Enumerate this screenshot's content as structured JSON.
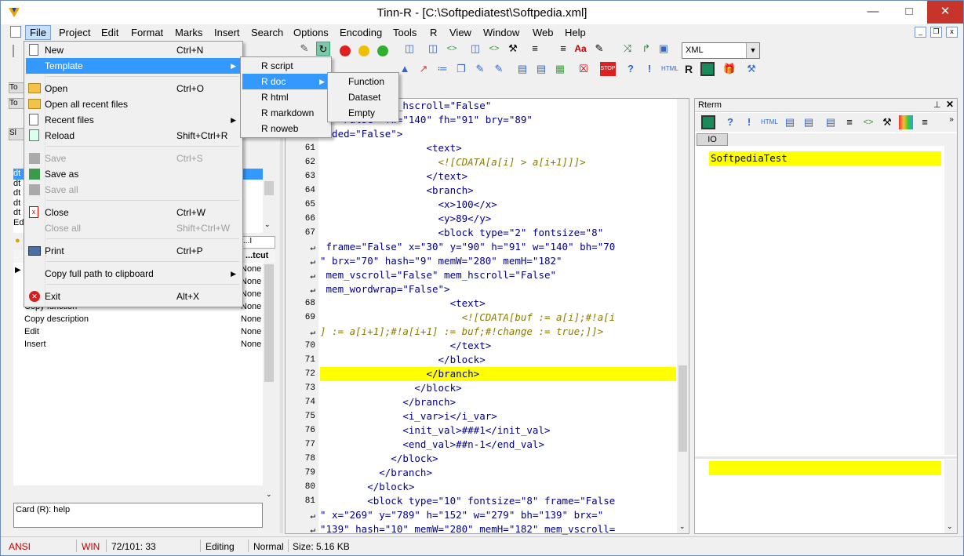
{
  "window": {
    "title": "Tinn-R - [C:\\Softpediatest\\Softpedia.xml]"
  },
  "menubar": [
    "File",
    "Project",
    "Edit",
    "Format",
    "Marks",
    "Insert",
    "Search",
    "Options",
    "Encoding",
    "Tools",
    "R",
    "View",
    "Window",
    "Web",
    "Help"
  ],
  "file_menu": [
    {
      "label": "New",
      "shortcut": "Ctrl+N",
      "disabled": false
    },
    {
      "label": "Template",
      "shortcut": "",
      "disabled": false,
      "submenu": true
    },
    {
      "label": "Open",
      "shortcut": "Ctrl+O",
      "disabled": false
    },
    {
      "label": "Open all recent files",
      "shortcut": "",
      "disabled": false
    },
    {
      "label": "Recent files",
      "shortcut": "",
      "disabled": false,
      "submenu": true
    },
    {
      "label": "Reload",
      "shortcut": "Shift+Ctrl+R",
      "disabled": false
    },
    {
      "label": "Save",
      "shortcut": "Ctrl+S",
      "disabled": true
    },
    {
      "label": "Save as",
      "shortcut": "",
      "disabled": false
    },
    {
      "label": "Save all",
      "shortcut": "",
      "disabled": true
    },
    {
      "label": "Close",
      "shortcut": "Ctrl+W",
      "disabled": false
    },
    {
      "label": "Close all",
      "shortcut": "Shift+Ctrl+W",
      "disabled": true
    },
    {
      "label": "Print",
      "shortcut": "Ctrl+P",
      "disabled": false
    },
    {
      "label": "Copy full path to clipboard",
      "shortcut": "",
      "disabled": false,
      "submenu": true
    },
    {
      "label": "Exit",
      "shortcut": "Alt+X",
      "disabled": false
    }
  ],
  "template_menu": [
    "R script",
    "R doc",
    "R html",
    "R markdown",
    "R noweb"
  ],
  "rdoc_menu": [
    "Function",
    "Dataset",
    "Empty"
  ],
  "syntax_select": "XML",
  "left_panel": {
    "shortcut_header": "...tcut",
    "rows": [
      {
        "name": "",
        "shortcut": "None"
      },
      {
        "name": "",
        "shortcut": "None"
      },
      {
        "name": "",
        "shortcut": "None"
      },
      {
        "name": "Copy function",
        "shortcut": "None"
      },
      {
        "name": "Copy description",
        "shortcut": "None"
      },
      {
        "name": "Edit",
        "shortcut": "None"
      },
      {
        "name": "Insert",
        "shortcut": "None"
      }
    ],
    "tree_items": [
      "dt",
      "dt",
      "dt",
      "dt",
      "dt",
      "Ed"
    ],
    "help_text": "Card (R): help"
  },
  "editor_lines": [
    {
      "n": "",
      "t": "l=\"False\" mem_hscroll=\"False\""
    },
    {
      "n": "",
      "t": "ap=\"False\" fw=\"140\" fh=\"91\" bry=\"89\""
    },
    {
      "n": "",
      "t": "olded=\"False\">"
    },
    {
      "n": "61",
      "t": "                  <text>"
    },
    {
      "n": "62",
      "t": "                    <![CDATA[a[i] > a[i+1]]]>"
    },
    {
      "n": "63",
      "t": "                  </text>"
    },
    {
      "n": "64",
      "t": "                  <branch>"
    },
    {
      "n": "65",
      "t": "                    <x>100</x>"
    },
    {
      "n": "66",
      "t": "                    <y>89</y>"
    },
    {
      "n": "67",
      "t": "                    <block type=\"2\" fontsize=\"8\""
    },
    {
      "n": "",
      "t": " frame=\"False\" x=\"30\" y=\"90\" h=\"91\" w=\"140\" bh=\"70"
    },
    {
      "n": "",
      "t": "\" brx=\"70\" hash=\"9\" memW=\"280\" memH=\"182\""
    },
    {
      "n": "",
      "t": " mem_vscroll=\"False\" mem_hscroll=\"False\""
    },
    {
      "n": "",
      "t": " mem_wordwrap=\"False\">"
    },
    {
      "n": "68",
      "t": "                      <text>"
    },
    {
      "n": "69",
      "t": "                        <![CDATA[buf := a[i];#!a[i"
    },
    {
      "n": "",
      "t": "] := a[i+1];#!a[i+1] := buf;#!change := true;]]>"
    },
    {
      "n": "70",
      "t": "                      </text>"
    },
    {
      "n": "71",
      "t": "                    </block>"
    },
    {
      "n": "72",
      "t": "                  </branch>"
    },
    {
      "n": "73",
      "t": "                </block>"
    },
    {
      "n": "74",
      "t": "              </branch>"
    },
    {
      "n": "75",
      "t": "              <i_var>i</i_var>"
    },
    {
      "n": "76",
      "t": "              <init_val>###1</init_val>"
    },
    {
      "n": "77",
      "t": "              <end_val>##n-1</end_val>"
    },
    {
      "n": "78",
      "t": "            </block>"
    },
    {
      "n": "79",
      "t": "          </branch>"
    },
    {
      "n": "80",
      "t": "        </block>"
    },
    {
      "n": "81",
      "t": "        <block type=\"10\" fontsize=\"8\" frame=\"False"
    },
    {
      "n": "",
      "t": "\" x=\"269\" y=\"789\" h=\"152\" w=\"279\" bh=\"139\" brx=\""
    },
    {
      "n": "",
      "t": "\"139\" hash=\"10\" memW=\"280\" memH=\"182\" mem_vscroll="
    }
  ],
  "highlight_line_index": 19,
  "rterm": {
    "title": "Rterm",
    "tab": "IO",
    "output": "SoftpediaTest"
  },
  "status": {
    "encoding": "ANSI",
    "eol": "WIN",
    "position": "72/101: 33",
    "mode": "Editing",
    "state": "Normal",
    "size": "Size: 5.16 KB"
  },
  "colors": {
    "menu_highlight": "#3399ff",
    "line_highlight": "#ffff00",
    "status_red": "#c00000"
  }
}
